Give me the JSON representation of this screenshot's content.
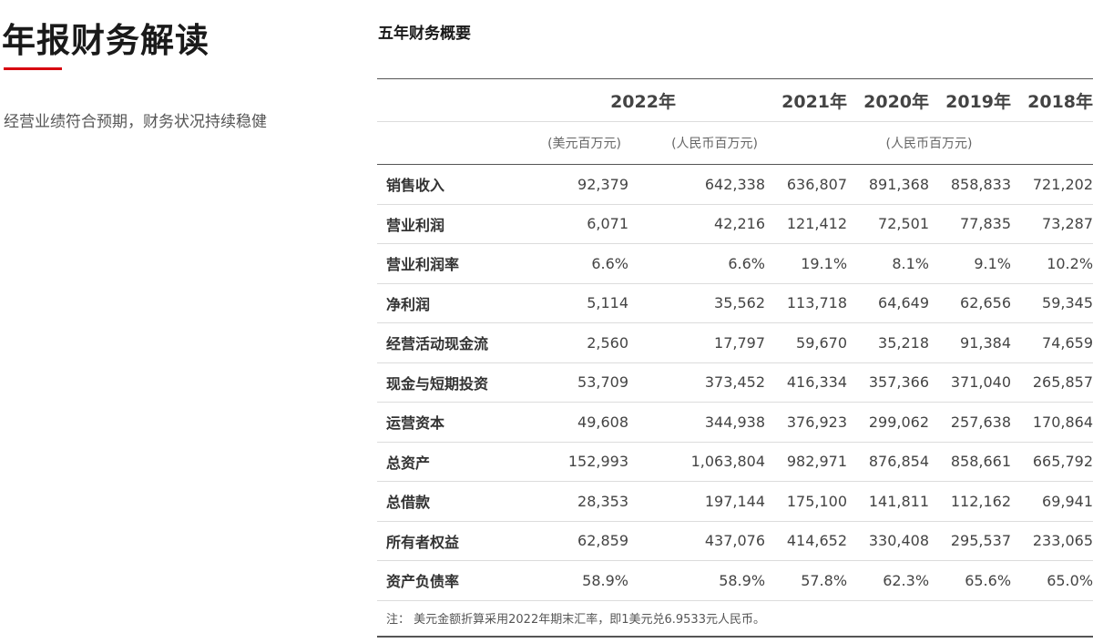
{
  "left": {
    "title": "年报财务解读",
    "intro": "经营业绩符合预期，财务状况持续稳健"
  },
  "section": {
    "title": "五年财务概要"
  },
  "table": {
    "years": [
      "2022年",
      "2021年",
      "2020年",
      "2019年",
      "2018年"
    ],
    "units": {
      "usd": "(美元百万元)",
      "rmb_2022": "(人民币百万元)",
      "rmb_other": "(人民币百万元)"
    },
    "rows": [
      {
        "label": "销售收入",
        "values": [
          "92,379",
          "642,338",
          "636,807",
          "891,368",
          "858,833",
          "721,202"
        ]
      },
      {
        "label": "营业利润",
        "values": [
          "6,071",
          "42,216",
          "121,412",
          "72,501",
          "77,835",
          "73,287"
        ]
      },
      {
        "label": "营业利润率",
        "values": [
          "6.6%",
          "6.6%",
          "19.1%",
          "8.1%",
          "9.1%",
          "10.2%"
        ]
      },
      {
        "label": "净利润",
        "values": [
          "5,114",
          "35,562",
          "113,718",
          "64,649",
          "62,656",
          "59,345"
        ]
      },
      {
        "label": "经营活动现金流",
        "values": [
          "2,560",
          "17,797",
          "59,670",
          "35,218",
          "91,384",
          "74,659"
        ]
      },
      {
        "label": "现金与短期投资",
        "values": [
          "53,709",
          "373,452",
          "416,334",
          "357,366",
          "371,040",
          "265,857"
        ]
      },
      {
        "label": "运营资本",
        "values": [
          "49,608",
          "344,938",
          "376,923",
          "299,062",
          "257,638",
          "170,864"
        ]
      },
      {
        "label": "总资产",
        "values": [
          "152,993",
          "1,063,804",
          "982,971",
          "876,854",
          "858,661",
          "665,792"
        ]
      },
      {
        "label": "总借款",
        "values": [
          "28,353",
          "197,144",
          "175,100",
          "141,811",
          "112,162",
          "69,941"
        ]
      },
      {
        "label": "所有者权益",
        "values": [
          "62,859",
          "437,076",
          "414,652",
          "330,408",
          "295,537",
          "233,065"
        ]
      },
      {
        "label": "资产负债率",
        "values": [
          "58.9%",
          "58.9%",
          "57.8%",
          "62.3%",
          "65.6%",
          "65.0%"
        ]
      }
    ],
    "note": "注： 美元金额折算采用2022年期末汇率，即1美元兑6.9533元人民币。"
  },
  "colors": {
    "accent": "#d7000f",
    "text": "#333333",
    "rule": "#555555",
    "divider": "#dcdcdc"
  }
}
